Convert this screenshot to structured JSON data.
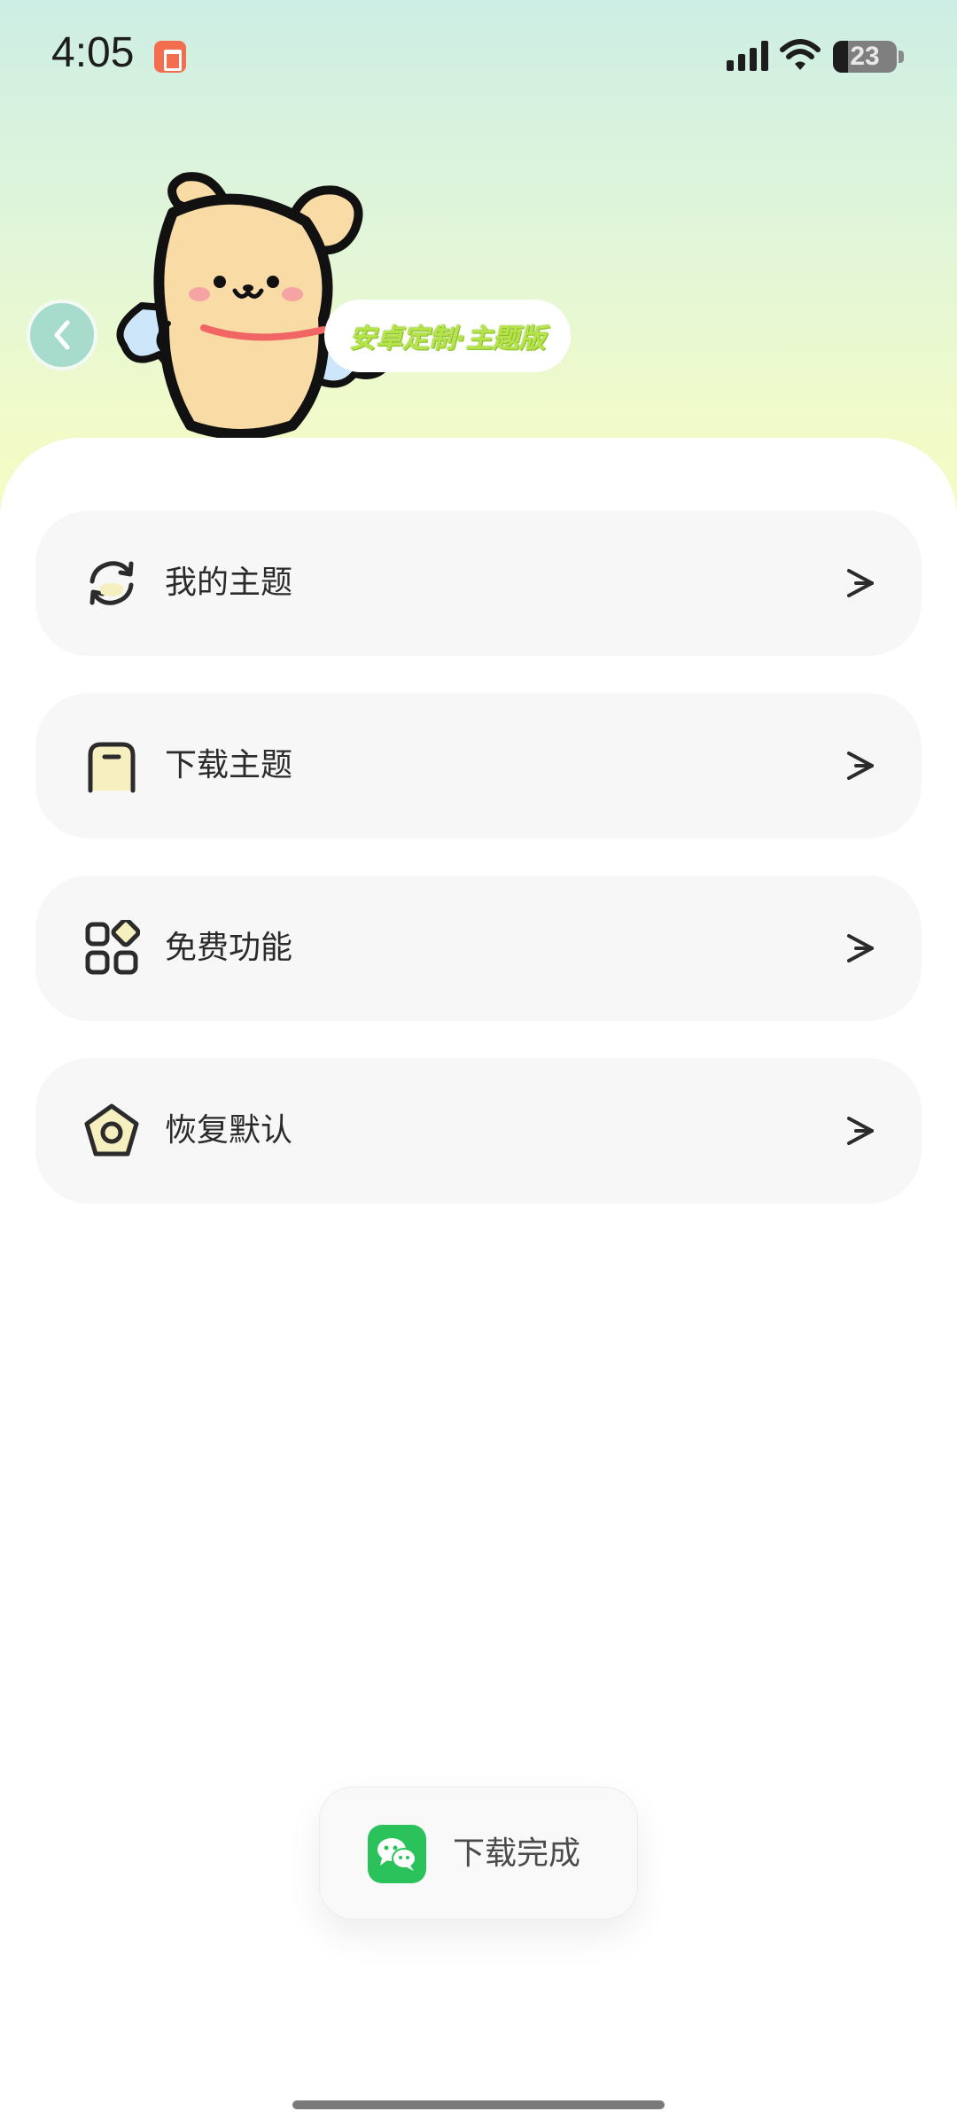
{
  "status_bar": {
    "time": "4:05",
    "battery_level": "23",
    "icons": [
      "notification-icon",
      "signal-icon",
      "wifi-icon",
      "battery-icon"
    ]
  },
  "header": {
    "tag_text": "安卓定制·主题版",
    "back_icon": "chevron-left-icon",
    "accent_color": "#a7dccc"
  },
  "menu": {
    "items": [
      {
        "label": "我的主题",
        "icon": "refresh-cycle-icon"
      },
      {
        "label": "下载主题",
        "icon": "phone-frame-icon"
      },
      {
        "label": "免费功能",
        "icon": "apps-grid-icon"
      },
      {
        "label": "恢复默认",
        "icon": "pentagon-icon"
      }
    ],
    "arrow_icon": "chevron-right-icon"
  },
  "toast": {
    "text": "下载完成",
    "icon": "wechat-icon",
    "icon_color": "#2bc25c"
  }
}
